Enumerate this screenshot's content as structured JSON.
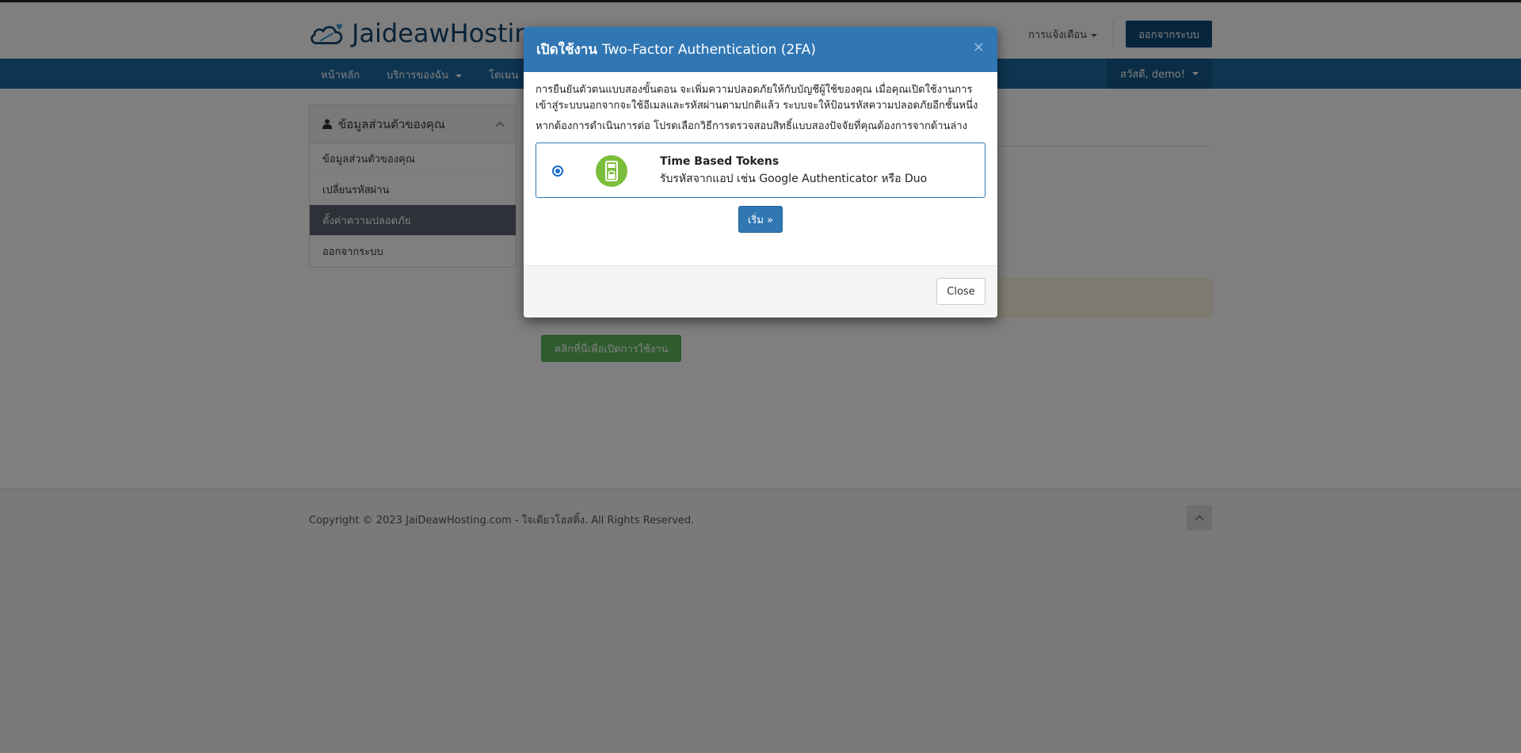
{
  "header": {
    "brand": "JaideawHosting",
    "notifications_label": "การแจ้งเตือน",
    "logout_button": "ออกจากระบบ"
  },
  "navbar": {
    "items": [
      {
        "label": "หน้าหลัก"
      },
      {
        "label": "บริการของฉัน"
      },
      {
        "label": "โดเมน"
      }
    ],
    "user_greeting": "สวัสดี, demo!"
  },
  "sidebar": {
    "title": "ข้อมูลส่วนตัวของคุณ",
    "items": [
      {
        "label": "ข้อมูลส่วนตัวของคุณ"
      },
      {
        "label": "เปลี่ยนรหัสผ่าน"
      },
      {
        "label": "ตั้งค่าความปลอดภัย",
        "active": true
      },
      {
        "label": "ออกจากระบบ"
      }
    ]
  },
  "main": {
    "enable_button": "คลิกที่นี่เพื่อเปิดการใช้งาน"
  },
  "footer": {
    "copyright": "Copyright © 2023 JaiDeawHosting.com - ใจเดียวโฮสติ้ง. All Rights Reserved."
  },
  "modal": {
    "title_strong": "เปิดใช้งาน",
    "title_rest": "Two-Factor Authentication (2FA)",
    "close_x": "×",
    "paragraph1": "การยืนยันตัวตนแบบสองขั้นตอน จะเพิ่มความปลอดภัยให้กับบัญชีผู้ใช้ของคุณ เมื่อคุณเปิดใช้งานการเข้าสู่ระบบนอกจากจะใช้อีเมลและรหัสผ่านตามปกติแล้ว ระบบจะให้ป้อนรหัสความปลอดภัยอีกชั้นหนึ่ง",
    "paragraph2": "หากต้องการดำเนินการต่อ โปรดเลือกวิธีการตรวจสอบสิทธิ์แบบสองปัจจัยที่คุณต้องการจากด้านล่าง",
    "option": {
      "title": "Time Based Tokens",
      "description": "รับรหัสจากแอป เช่น Google Authenticator หรือ Duo",
      "selected": true
    },
    "start_button": "เริ่ม »",
    "close_button": "Close"
  },
  "colors": {
    "brand_blue": "#13446e",
    "navbar": "#1a6aa3",
    "modal_header": "#3177b4",
    "success": "#5cb85c"
  }
}
